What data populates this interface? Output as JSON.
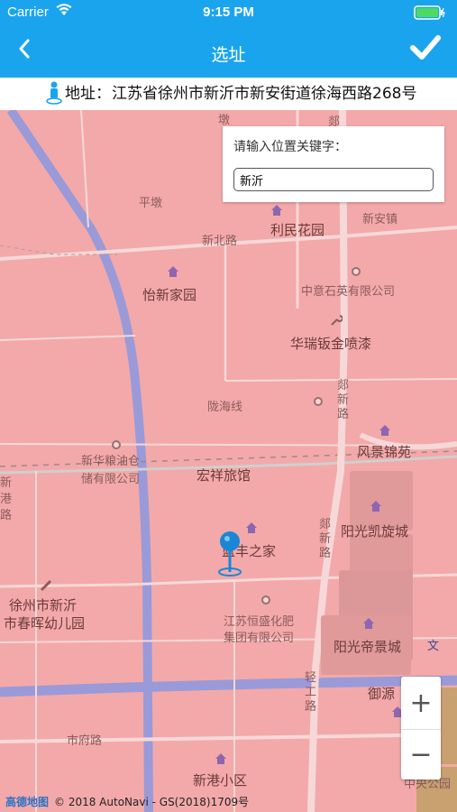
{
  "status": {
    "carrier": "Carrier",
    "time": "9:15 PM"
  },
  "nav": {
    "title": "选址",
    "back_icon": "chevron-left-icon",
    "confirm_icon": "checkmark-icon"
  },
  "address": {
    "label": "地址：",
    "value": "江苏省徐州市新沂市新安街道徐海西路268号"
  },
  "search": {
    "prompt": "请输入位置关键字：",
    "value": "新沂"
  },
  "map": {
    "pois": [
      {
        "name": "怡新家园"
      },
      {
        "name": "利民花园"
      },
      {
        "name": "中意石英有限公司"
      },
      {
        "name": "华瑞钣金喷漆"
      },
      {
        "name": "风景锦苑"
      },
      {
        "name": "宏祥旅馆"
      },
      {
        "name": "新华粮油仓"
      },
      {
        "name": "储有限公司"
      },
      {
        "name": "阳光凯旋城"
      },
      {
        "name": "蓝丰之家"
      },
      {
        "name": "徐州市新沂"
      },
      {
        "name": "市春晖幼儿园"
      },
      {
        "name": "江苏恒盛化肥"
      },
      {
        "name": "集团有限公司"
      },
      {
        "name": "阳光帝景城"
      },
      {
        "name": "新港小区"
      },
      {
        "name": "新安镇"
      },
      {
        "name": "平墩"
      }
    ],
    "roads": [
      {
        "name": "新北路"
      },
      {
        "name": "陇海线"
      },
      {
        "name": "郯新路"
      },
      {
        "name": "市府路"
      },
      {
        "name": "轻工路"
      },
      {
        "name": "郯新路"
      },
      {
        "name": "御源"
      },
      {
        "name": "中央公园"
      },
      {
        "name": "新"
      },
      {
        "name": "港"
      },
      {
        "name": "路"
      },
      {
        "name": "墩"
      },
      {
        "name": "郯"
      },
      {
        "name": "新"
      }
    ]
  },
  "zoom": {
    "in": "+",
    "out": "−"
  },
  "attribution": {
    "logo": "高德地图",
    "text": "© 2018 AutoNavi - GS(2018)1709号"
  },
  "colors": {
    "accent": "#1aa4ee",
    "map_bg": "#f3a9a9",
    "road": "#9a9ad8"
  }
}
